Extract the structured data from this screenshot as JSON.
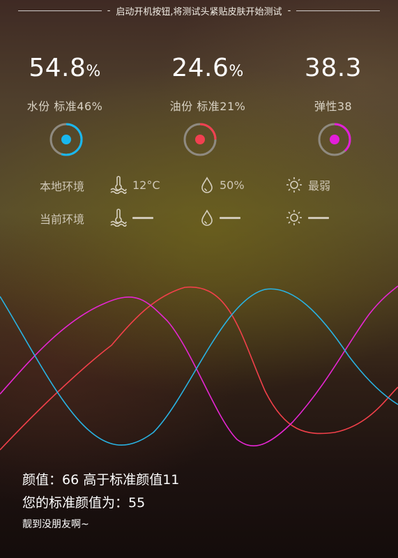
{
  "hint": {
    "text": "启动开机按钮,将测试头紧贴皮肤开始测试"
  },
  "metrics": [
    {
      "value": "54.8",
      "unit": "%",
      "label": "水份 标准46%",
      "color": "#19b7ee",
      "fraction": 0.55
    },
    {
      "value": "24.6",
      "unit": "%",
      "label": "油份 标准21%",
      "color": "#f24050",
      "fraction": 0.25
    },
    {
      "value": "38.3",
      "unit": "",
      "label": "弹性38",
      "color": "#e21ed8",
      "fraction": 0.38
    }
  ],
  "environment": {
    "local": {
      "label": "本地环境",
      "temperature": "12°C",
      "humidity": "50%",
      "light": "最弱"
    },
    "current": {
      "label": "当前环境"
    }
  },
  "icons": {
    "temperature": "thermometer-water-icon",
    "humidity": "droplet-icon",
    "light": "sun-icon"
  },
  "waves": {
    "colors": {
      "cyan": "#29b3e3",
      "red": "#f2404a",
      "magenta": "#e626d3"
    }
  },
  "result": {
    "line1": "颜值：66 高于标准颜值11",
    "line2": "您的标准颜值为：55",
    "line3": "靓到没朋友啊~"
  }
}
